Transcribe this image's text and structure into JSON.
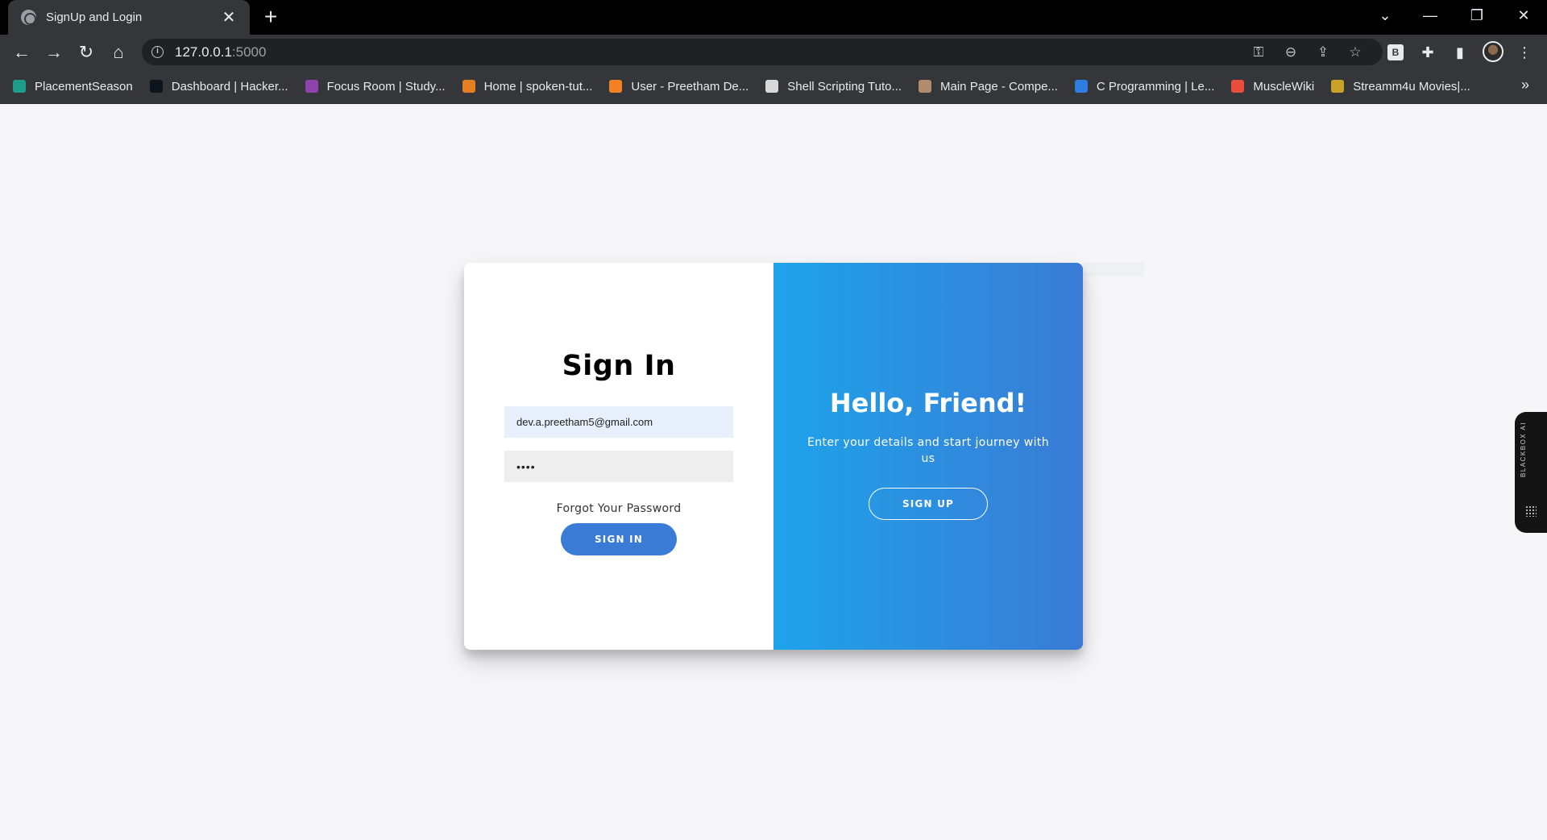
{
  "browser": {
    "tab_title": "SignUp and Login",
    "url_host": "127.0.0.1",
    "url_port": ":5000",
    "bookmarks": [
      {
        "label": "PlacementSeason",
        "color": "#1e9e8a"
      },
      {
        "label": "Dashboard | Hacker...",
        "color": "#0e141e"
      },
      {
        "label": "Focus Room | Study...",
        "color": "#8e44ad"
      },
      {
        "label": "Home | spoken-tut...",
        "color": "#e67e22"
      },
      {
        "label": "User - Preetham De...",
        "color": "#f48024"
      },
      {
        "label": "Shell Scripting Tuto...",
        "color": "#d8d8d8"
      },
      {
        "label": "Main Page - Compe...",
        "color": "#b08b6e"
      },
      {
        "label": "C Programming | Le...",
        "color": "#2f7de1"
      },
      {
        "label": "MuscleWiki",
        "color": "#e74c3c"
      },
      {
        "label": "Streamm4u Movies|...",
        "color": "#c9a227"
      }
    ]
  },
  "signin": {
    "title": "Sign In",
    "email_value": "dev.a.preetham5@gmail.com",
    "password_value": "••••",
    "forgot_label": "Forgot Your Password",
    "button_label": "SIGN IN"
  },
  "overlay": {
    "title": "Hello, Friend!",
    "subtitle": "Enter your details and start journey with us",
    "button_label": "SIGN UP"
  },
  "side_widget": {
    "label": "BLACKBOX AI"
  },
  "colors": {
    "accent": "#3a7bd5",
    "gradient_start": "#1ea3ea",
    "gradient_end": "#3a7bd5"
  }
}
